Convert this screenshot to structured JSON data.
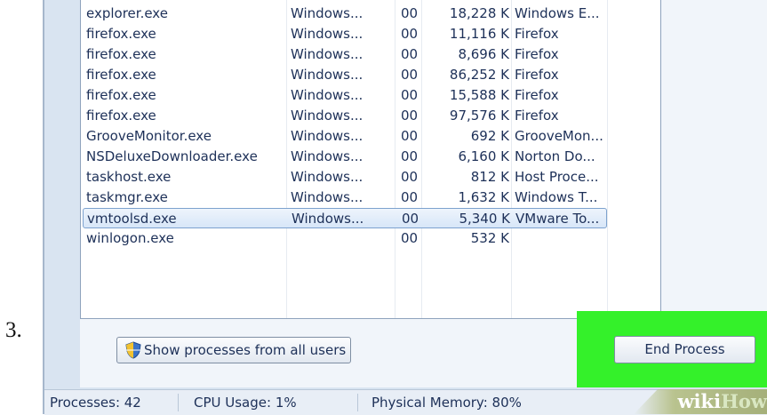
{
  "step": "3.",
  "processes": [
    {
      "name": "explorer.exe",
      "user": "Windows...",
      "cpu": "00",
      "memory": "18,228 K",
      "description": "Windows E..."
    },
    {
      "name": "firefox.exe",
      "user": "Windows...",
      "cpu": "00",
      "memory": "11,116 K",
      "description": "Firefox"
    },
    {
      "name": "firefox.exe",
      "user": "Windows...",
      "cpu": "00",
      "memory": "8,696 K",
      "description": "Firefox"
    },
    {
      "name": "firefox.exe",
      "user": "Windows...",
      "cpu": "00",
      "memory": "86,252 K",
      "description": "Firefox"
    },
    {
      "name": "firefox.exe",
      "user": "Windows...",
      "cpu": "00",
      "memory": "15,588 K",
      "description": "Firefox"
    },
    {
      "name": "firefox.exe",
      "user": "Windows...",
      "cpu": "00",
      "memory": "97,576 K",
      "description": "Firefox"
    },
    {
      "name": "GrooveMonitor.exe",
      "user": "Windows...",
      "cpu": "00",
      "memory": "692 K",
      "description": "GrooveMon..."
    },
    {
      "name": "NSDeluxeDownloader.exe",
      "user": "Windows...",
      "cpu": "00",
      "memory": "6,160 K",
      "description": "Norton Do..."
    },
    {
      "name": "taskhost.exe",
      "user": "Windows...",
      "cpu": "00",
      "memory": "812 K",
      "description": "Host Proce..."
    },
    {
      "name": "taskmgr.exe",
      "user": "Windows...",
      "cpu": "00",
      "memory": "1,632 K",
      "description": "Windows T..."
    },
    {
      "name": "vmtoolsd.exe",
      "user": "Windows...",
      "cpu": "00",
      "memory": "5,340 K",
      "description": "VMware To...",
      "selected": true
    },
    {
      "name": "winlogon.exe",
      "user": "",
      "cpu": "00",
      "memory": "532 K",
      "description": ""
    }
  ],
  "buttons": {
    "show_all": "Show processes from all users",
    "end_process": "End Process"
  },
  "status": {
    "processes": "Processes: 42",
    "cpu": "CPU Usage: 1%",
    "memory": "Physical Memory: 80%"
  },
  "watermark": {
    "part1": "wiki",
    "part2": "How"
  },
  "colors": {
    "highlight": "#34f12a",
    "selection": "#d7e6f8"
  },
  "icons": {
    "show_all": "uac-shield-icon"
  }
}
